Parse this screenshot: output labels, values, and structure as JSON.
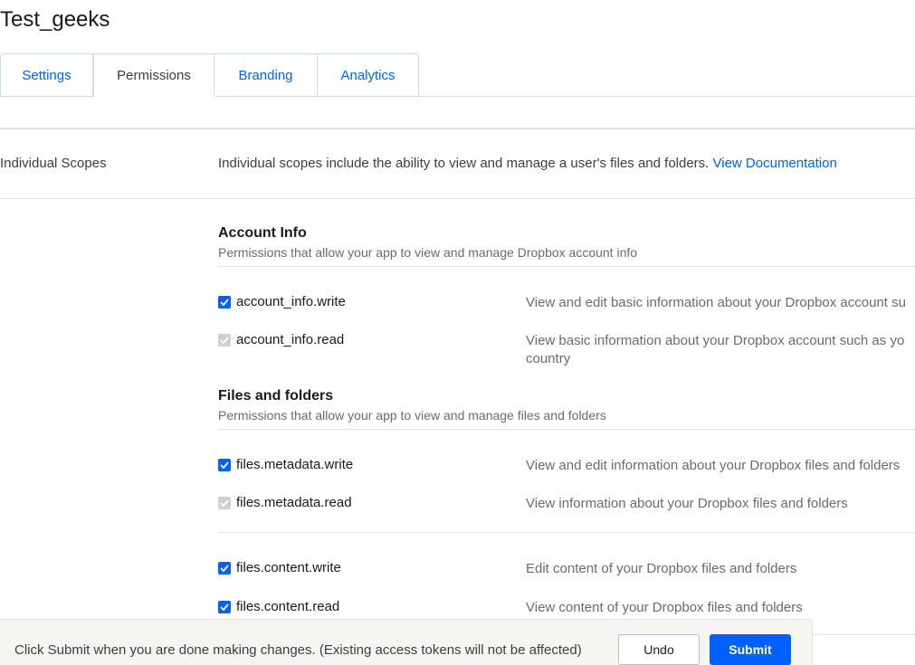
{
  "app": {
    "title": "Test_geeks"
  },
  "tabs": [
    {
      "label": "Settings",
      "active": false
    },
    {
      "label": "Permissions",
      "active": true
    },
    {
      "label": "Branding",
      "active": false
    },
    {
      "label": "Analytics",
      "active": false
    }
  ],
  "scopes": {
    "label": "Individual Scopes",
    "description": "Individual scopes include the ability to view and manage a user's files and folders.",
    "doc_link": "View Documentation"
  },
  "groups": [
    {
      "title": "Account Info",
      "subtitle": "Permissions that allow your app to view and manage Dropbox account info",
      "permissions": [
        {
          "name": "account_info.write",
          "description": "View and edit basic information about your Dropbox account su",
          "state": "checked"
        },
        {
          "name": "account_info.read",
          "description": "View basic information about your Dropbox account such as yo country",
          "state": "disabled"
        }
      ]
    },
    {
      "title": "Files and folders",
      "subtitle": "Permissions that allow your app to view and manage files and folders",
      "permissions": [
        {
          "name": "files.metadata.write",
          "description": "View and edit information about your Dropbox files and folders",
          "state": "checked"
        },
        {
          "name": "files.metadata.read",
          "description": "View information about your Dropbox files and folders",
          "state": "disabled"
        },
        {
          "name": "files.content.write",
          "description": "Edit content of your Dropbox files and folders",
          "state": "checked"
        },
        {
          "name": "files.content.read",
          "description": "View content of your Dropbox files and folders",
          "state": "checked"
        }
      ]
    }
  ],
  "footer": {
    "message": "Click Submit when you are done making changes. (Existing access tokens will not be affected)",
    "undo_label": "Undo",
    "submit_label": "Submit"
  },
  "colors": {
    "accent": "#0061fe",
    "text": "#1e1919",
    "muted": "#6b6b6b",
    "footer_bg": "#f7f5f2"
  }
}
